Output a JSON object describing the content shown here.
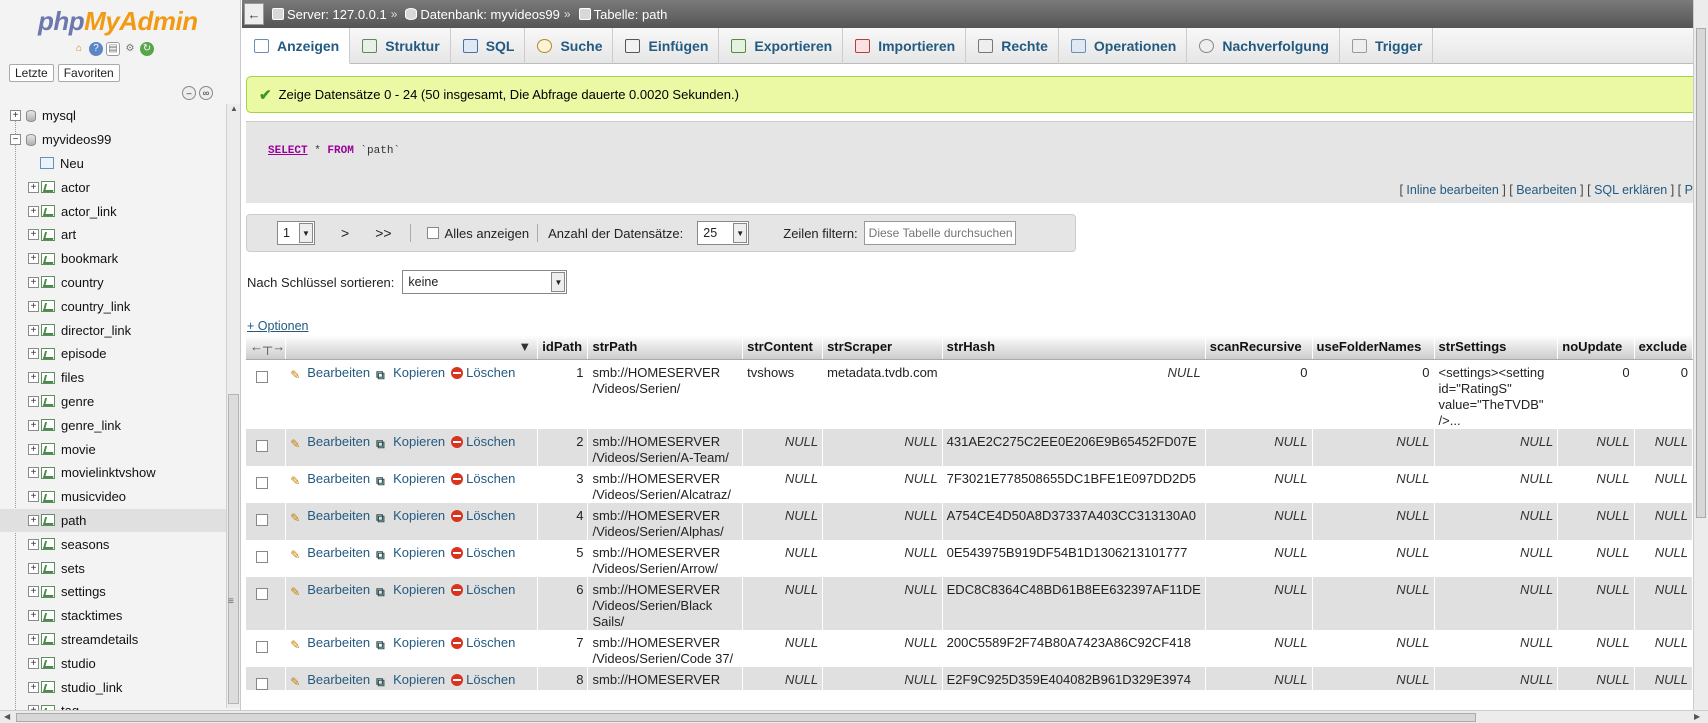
{
  "sidebar": {
    "logo_php": "php",
    "logo_myadmin": "MyAdmin",
    "quick_icons": [
      "home-icon",
      "info-icon",
      "document-icon",
      "settings-icon",
      "reload-icon"
    ],
    "tabs": [
      "Letzte",
      "Favoriten"
    ],
    "databases": [
      {
        "name": "mysql",
        "expanded": false
      },
      {
        "name": "myvideos99",
        "expanded": true
      }
    ],
    "new_label": "Neu",
    "tables": [
      "actor",
      "actor_link",
      "art",
      "bookmark",
      "country",
      "country_link",
      "director_link",
      "episode",
      "files",
      "genre",
      "genre_link",
      "movie",
      "movielinktvshow",
      "musicvideo",
      "path",
      "seasons",
      "sets",
      "settings",
      "stacktimes",
      "streamdetails",
      "studio",
      "studio_link",
      "tag"
    ],
    "selected_table": "path"
  },
  "breadcrumb": {
    "server": "Server: 127.0.0.1",
    "database": "Datenbank: myvideos99",
    "table": "Tabelle: path",
    "sep": "»"
  },
  "menu": [
    {
      "label": "Anzeigen",
      "icon": "browse-icon",
      "active": true
    },
    {
      "label": "Struktur",
      "icon": "structure-icon"
    },
    {
      "label": "SQL",
      "icon": "sql-icon"
    },
    {
      "label": "Suche",
      "icon": "search-icon"
    },
    {
      "label": "Einfügen",
      "icon": "insert-icon"
    },
    {
      "label": "Exportieren",
      "icon": "export-icon"
    },
    {
      "label": "Importieren",
      "icon": "import-icon"
    },
    {
      "label": "Rechte",
      "icon": "privileges-icon"
    },
    {
      "label": "Operationen",
      "icon": "wrench-icon"
    },
    {
      "label": "Nachverfolgung",
      "icon": "eye-icon"
    },
    {
      "label": "Trigger",
      "icon": "trigger-icon"
    }
  ],
  "success_message": "Zeige Datensätze 0 - 24 (50 insgesamt, Die Abfrage dauerte 0.0020 Sekunden.)",
  "sql": {
    "select": "SELECT",
    "star": " * ",
    "from": "FROM",
    "table": " `path`"
  },
  "sql_links": {
    "inline_edit": "Inline bearbeiten",
    "edit": "Bearbeiten",
    "explain": "SQL erklären",
    "php": "PH"
  },
  "navigation": {
    "page": "1",
    "next": ">",
    "last": ">>",
    "show_all": "Alles anzeigen",
    "rows_label": "Anzahl der Datensätze:",
    "rows_value": "25",
    "filter_label": "Zeilen filtern:",
    "filter_placeholder": "Diese Tabelle durchsuchen"
  },
  "sort": {
    "label": "Nach Schlüssel sortieren:",
    "value": "keine"
  },
  "options_link": "+ Optionen",
  "table": {
    "columns": [
      "idPath",
      "strPath",
      "strContent",
      "strScraper",
      "strHash",
      "scanRecursive",
      "useFolderNames",
      "strSettings",
      "noUpdate",
      "exclude"
    ],
    "actions": {
      "edit": "Bearbeiten",
      "copy": "Kopieren",
      "delete": "Löschen"
    },
    "rows": [
      [
        "1",
        "smb://HOMESERVER /Videos/Serien/",
        "tvshows",
        "metadata.tvdb.com",
        "NULL",
        "0",
        "0",
        "<settings><setting id=\"RatingS\" value=\"TheTVDB\" />...",
        "0",
        "0"
      ],
      [
        "2",
        "smb://HOMESERVER /Videos/Serien/A-Team/",
        "NULL",
        "NULL",
        "431AE2C275C2EE0E206E9B65452FD07E",
        "NULL",
        "NULL",
        "NULL",
        "NULL",
        "NULL"
      ],
      [
        "3",
        "smb://HOMESERVER /Videos/Serien/Alcatraz/",
        "NULL",
        "NULL",
        "7F3021E778508655DC1BFE1E097DD2D5",
        "NULL",
        "NULL",
        "NULL",
        "NULL",
        "NULL"
      ],
      [
        "4",
        "smb://HOMESERVER /Videos/Serien/Alphas/",
        "NULL",
        "NULL",
        "A754CE4D50A8D37337A403CC313130A0",
        "NULL",
        "NULL",
        "NULL",
        "NULL",
        "NULL"
      ],
      [
        "5",
        "smb://HOMESERVER /Videos/Serien/Arrow/",
        "NULL",
        "NULL",
        "0E543975B919DF54B1D1306213101777",
        "NULL",
        "NULL",
        "NULL",
        "NULL",
        "NULL"
      ],
      [
        "6",
        "smb://HOMESERVER /Videos/Serien/Black Sails/",
        "NULL",
        "NULL",
        "EDC8C8364C48BD61B8EE632397AF11DE",
        "NULL",
        "NULL",
        "NULL",
        "NULL",
        "NULL"
      ],
      [
        "7",
        "smb://HOMESERVER /Videos/Serien/Code 37/",
        "NULL",
        "NULL",
        "200C5589F2F74B80A7423A86C92CF418",
        "NULL",
        "NULL",
        "NULL",
        "NULL",
        "NULL"
      ],
      [
        "8",
        "smb://HOMESERVER",
        "NULL",
        "NULL",
        "E2F9C925D359E404082B961D329E3974",
        "NULL",
        "NULL",
        "NULL",
        "NULL",
        "NULL"
      ]
    ]
  }
}
